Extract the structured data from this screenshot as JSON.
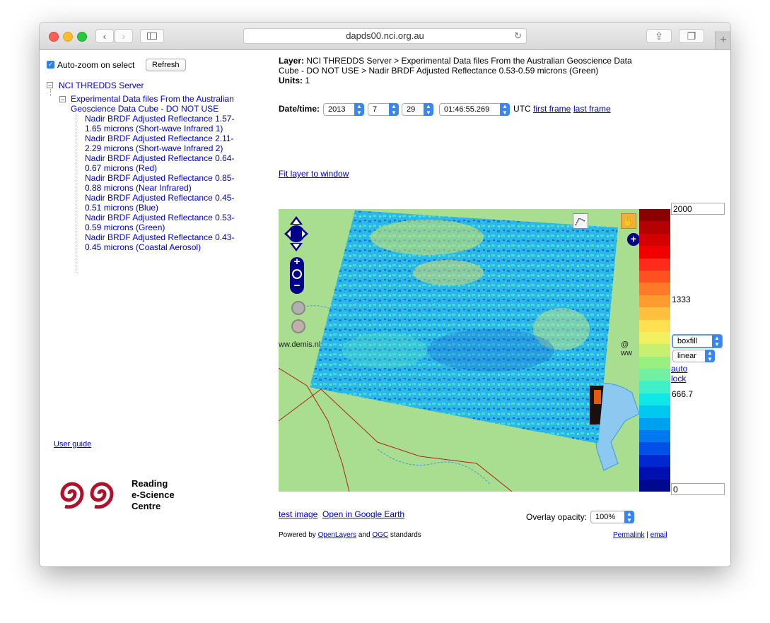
{
  "browser": {
    "url": "dapds00.nci.org.au"
  },
  "sidebar": {
    "autozoom_label": "Auto-zoom on select",
    "refresh_label": "Refresh",
    "root_label": "NCI THREDDS Server",
    "folder_label": "Experimental Data files From the Australian Geoscience Data Cube - DO NOT USE",
    "layers": [
      {
        "label": "Nadir BRDF Adjusted Reflectance 1.57-1.65 microns (Short-wave Infrared 1)"
      },
      {
        "label": "Nadir BRDF Adjusted Reflectance 2.11-2.29 microns (Short-wave Infrared 2)"
      },
      {
        "label": "Nadir BRDF Adjusted Reflectance 0.64-0.67 microns (Red)"
      },
      {
        "label": "Nadir BRDF Adjusted Reflectance 0.85-0.88 microns (Near Infrared)"
      },
      {
        "label": "Nadir BRDF Adjusted Reflectance 0.45-0.51 microns (Blue)"
      },
      {
        "label": "Nadir BRDF Adjusted Reflectance 0.53-0.59 microns (Green)"
      },
      {
        "label": "Nadir BRDF Adjusted Reflectance 0.43-0.45 microns (Coastal Aerosol)"
      }
    ],
    "user_guide": "User guide",
    "logo_text": [
      "Reading",
      "e-Science",
      "Centre"
    ]
  },
  "header": {
    "layer_label": "Layer:",
    "layer_value": "NCI THREDDS Server > Experimental Data files From the Australian Geoscience Data Cube - DO NOT USE > Nadir BRDF Adjusted Reflectance 0.53-0.59 microns (Green)",
    "units_label": "Units:",
    "units_value": "1",
    "datetime_label": "Date/time:",
    "year": "2013",
    "month": "7",
    "day": "29",
    "time": "01:46:55.269",
    "utc": "UTC",
    "first_frame": "first frame",
    "last_frame": "last frame",
    "fit_layer": "Fit layer to window"
  },
  "map": {
    "attribution_left": "ww.demis.nl",
    "attribution_right": "@ ww"
  },
  "colorbar": {
    "max": "2000",
    "mid_high": "1333",
    "mid_low": "666.7",
    "min": "0",
    "style": "boxfill",
    "scale": "linear",
    "auto": "auto",
    "lock": "lock",
    "colors": [
      "#8b0000",
      "#b40000",
      "#d40000",
      "#f00000",
      "#ff2a1a",
      "#ff5020",
      "#ff7a28",
      "#ff9c30",
      "#ffc040",
      "#ffe050",
      "#f0f060",
      "#c8f070",
      "#98f080",
      "#70f0a0",
      "#40f0c8",
      "#10e8e8",
      "#00c8f0",
      "#00a0f0",
      "#0078f0",
      "#0050e8",
      "#0028d0",
      "#0010b0",
      "#000890"
    ],
    "scale_max": 2000
  },
  "footer": {
    "test_image": "test image",
    "google_earth": "Open in Google Earth",
    "opacity_label": "Overlay opacity:",
    "opacity_value": "100%",
    "powered_prefix": "Powered by",
    "openlayers": "OpenLayers",
    "and": "and",
    "ogc": "OGC",
    "standards": "standards",
    "permalink": "Permalink",
    "sep": "|",
    "email": "email"
  }
}
